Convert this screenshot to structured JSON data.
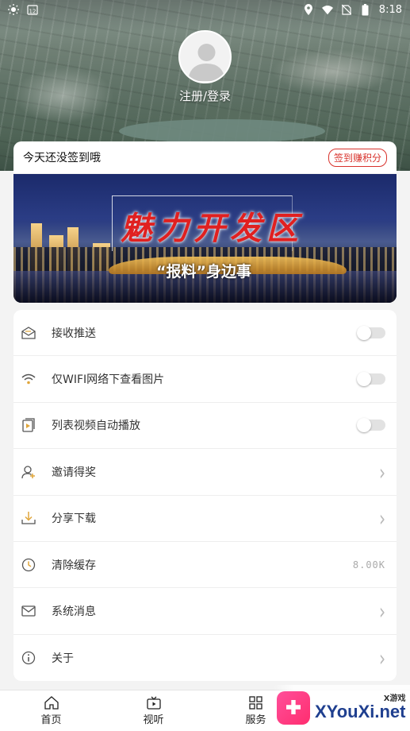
{
  "status_bar": {
    "time": "8:18",
    "calendar_day": "12",
    "left_icons": [
      "weather-sun-icon",
      "calendar-icon"
    ],
    "right_icons": [
      "location-icon",
      "wifi-icon",
      "no-sim-icon",
      "battery-icon"
    ]
  },
  "profile": {
    "login_text": "注册/登录"
  },
  "signin": {
    "text": "今天还没签到哦",
    "button": "签到赚积分"
  },
  "banner": {
    "title": "魅力开发区",
    "subtitle": "“报料”身边事"
  },
  "settings": [
    {
      "label": "接收推送",
      "icon": "envelope-open-icon",
      "control": "toggle",
      "on": false
    },
    {
      "label": "仅WIFI网络下查看图片",
      "icon": "wifi-icon",
      "control": "toggle",
      "on": false
    },
    {
      "label": "列表视频自动播放",
      "icon": "video-play-icon",
      "control": "toggle",
      "on": false
    },
    {
      "label": "邀请得奖",
      "icon": "user-add-icon",
      "control": "chevron"
    },
    {
      "label": "分享下载",
      "icon": "download-icon",
      "control": "chevron"
    },
    {
      "label": "清除缓存",
      "icon": "clock-icon",
      "control": "value",
      "value": "8.00K"
    },
    {
      "label": "系统消息",
      "icon": "mail-icon",
      "control": "chevron"
    },
    {
      "label": "关于",
      "icon": "info-icon",
      "control": "chevron"
    }
  ],
  "bottom_nav": [
    {
      "label": "首页",
      "icon": "home-icon"
    },
    {
      "label": "视听",
      "icon": "tv-icon"
    },
    {
      "label": "服务",
      "icon": "grid-icon"
    }
  ],
  "watermark": {
    "top_text": "X游戏",
    "brand": "XYouXi.net"
  },
  "colors": {
    "accent_red": "#d8322c",
    "background": "#f3f3f3",
    "card": "#ffffff"
  }
}
